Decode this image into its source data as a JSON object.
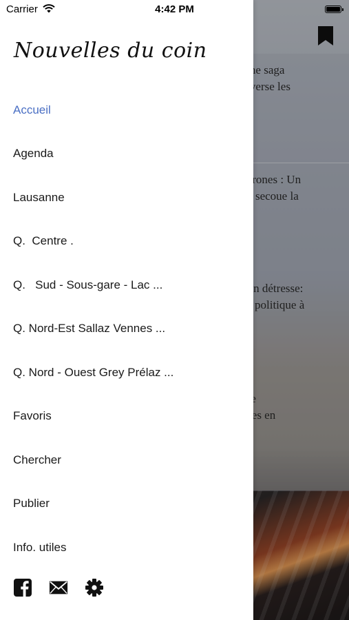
{
  "status_bar": {
    "carrier": "Carrier",
    "time": "4:42 PM"
  },
  "background": {
    "articles": [
      {
        "line1": "riche saga",
        "line2": "traverse les"
      },
      {
        "line1": "u drones : Un",
        "line2": "qui secoue la"
      },
      {
        "line1": "ts en détresse:",
        "line2": "are politique à"
      },
      {
        "line1": "s de",
        "line2": "lèves en"
      }
    ]
  },
  "drawer": {
    "brand": "Nouvelles du coin",
    "menu": [
      "Accueil",
      "Agenda",
      "Lausanne",
      "Q.  Centre .",
      "Q.   Sud - Sous-gare - Lac ...",
      "Q. Nord-Est Sallaz Vennes ...",
      "Q. Nord - Ouest Grey Prélaz ...",
      "Favoris",
      "Chercher",
      "Publier",
      "Info. utiles"
    ],
    "active_item": "Accueil",
    "accent_color": "#4a6fc4"
  },
  "footer_icons": [
    "facebook-icon",
    "mail-icon",
    "gear-icon"
  ]
}
